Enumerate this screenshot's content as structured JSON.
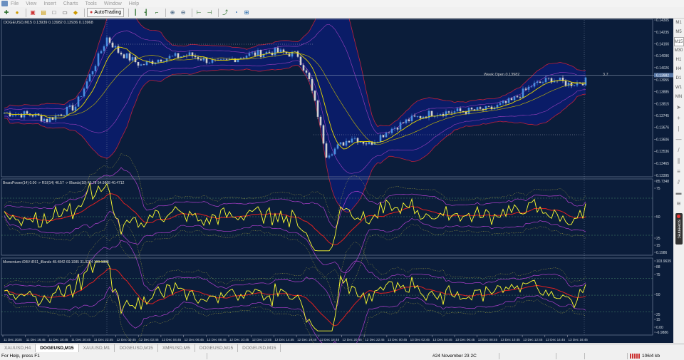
{
  "menu": [
    "File",
    "View",
    "Insert",
    "Charts",
    "Tools",
    "Window",
    "Help"
  ],
  "toolbar": {
    "autotrading_label": "AutoTrading"
  },
  "main_chart": {
    "title": "DOGEUSD,M15  0.13939 0.13982 0.13936 0.13968",
    "current_price": "0.13982",
    "week_open_label": "Week Open 0.13982",
    "right_label": "3.7",
    "price_ticks": [
      "0.14305",
      "0.14235",
      "0.14166",
      "0.14096",
      "0.14026",
      "0.13955",
      "0.13885",
      "0.13815",
      "0.13745",
      "0.13676",
      "0.13606",
      "0.13536",
      "0.13465",
      "0.13395"
    ],
    "price_min": 0.13395,
    "price_max": 0.14305,
    "price_path": [
      [
        0,
        0.1376
      ],
      [
        10,
        0.1375
      ],
      [
        15,
        0.1372
      ],
      [
        25,
        0.138
      ],
      [
        32,
        0.1405
      ],
      [
        36,
        0.142
      ],
      [
        40,
        0.1412
      ],
      [
        48,
        0.1404
      ],
      [
        55,
        0.1408
      ],
      [
        65,
        0.141
      ],
      [
        75,
        0.1405
      ],
      [
        85,
        0.141
      ],
      [
        95,
        0.1412
      ],
      [
        103,
        0.141
      ],
      [
        107,
        0.1395
      ],
      [
        110,
        0.1375
      ],
      [
        113,
        0.1352
      ],
      [
        116,
        0.1355
      ],
      [
        122,
        0.1362
      ],
      [
        128,
        0.1358
      ],
      [
        135,
        0.1366
      ],
      [
        142,
        0.1372
      ],
      [
        150,
        0.1376
      ],
      [
        160,
        0.1377
      ],
      [
        170,
        0.1378
      ],
      [
        178,
        0.1383
      ],
      [
        185,
        0.1392
      ],
      [
        192,
        0.1396
      ],
      [
        198,
        0.1393
      ],
      [
        205,
        0.1395
      ]
    ]
  },
  "pane2": {
    "title": "BearsPower(14) 0.00 -> RSI(14) 46.57 -> IBands(18) 46.78  54.9868 40.4712",
    "ticks": [
      "85.7348",
      "75",
      "50",
      "25",
      "15",
      "0.1986"
    ]
  },
  "pane3": {
    "title": "Momentum-iOBV-iR51_iBands 48.4842 69.1085 31.3274 100.1888",
    "ticks": [
      "103.9639",
      "88",
      "75",
      "50",
      "25",
      "15",
      "0.00",
      "-6.9886"
    ]
  },
  "time_labels": [
    "11 Dec 2025",
    "11 Dec 16:45",
    "11 Dec 18:45",
    "11 Dec 20:45",
    "11 Dec 22:45",
    "12 Dec 00:45",
    "12 Dec 02:45",
    "12 Dec 04:45",
    "12 Dec 06:45",
    "12 Dec 08:45",
    "12 Dec 10:45",
    "12 Dec 12:45",
    "12 Dec 14:45",
    "12 Dec 16:45",
    "12 Dec 18:45",
    "12 Dec 20:45",
    "12 Dec 22:45",
    "13 Dec 00:45",
    "13 Dec 02:45",
    "13 Dec 04:45",
    "13 Dec 06:45",
    "13 Dec 08:45",
    "13 Dec 10:45",
    "13 Dec 12:45",
    "13 Dec 14:45",
    "13 Dec 16:45"
  ],
  "timeframes": [
    "M1",
    "M5",
    "M15",
    "M30",
    "H1",
    "H4",
    "D1",
    "W1",
    "MN"
  ],
  "active_timeframe": "M15",
  "screenrec_label": "screenrec",
  "tabs": [
    "XAUUSD,H4",
    "DOGEUSD,M15",
    "XAUUSD,M1",
    "DOGEUSD,M15",
    "XMRUSD,M5",
    "DOGEUSD,M15",
    "DOGEUSD,M15"
  ],
  "active_tab": 1,
  "status": {
    "help": "For Help, press F1",
    "profile": "#24 November 23 2C",
    "traffic": "106/4 kb"
  },
  "colors": {
    "bg": "#0b1d3a",
    "bull": "#4a8fe0",
    "bear": "#d0d0d0",
    "ma": "#e8d800",
    "band_outer": "#c0203a",
    "band_mid": "#a040c0",
    "grid": "#5a6a80"
  }
}
